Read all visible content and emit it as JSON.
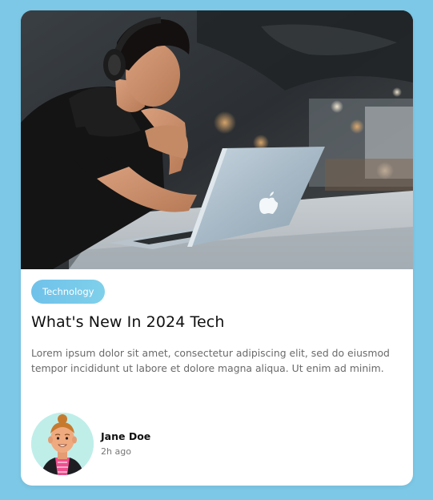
{
  "card": {
    "tag_label": "Technology",
    "title": "What's New In 2024 Tech",
    "body": "Lorem ipsum dolor sit amet, consectetur adipiscing elit, sed do eiusmod tempor incididunt ut labore et dolore magna aliqua. Ut enim ad minim.",
    "author": {
      "name": "Jane Doe",
      "time": "2h ago"
    }
  },
  "icons": {
    "avatar": "avatar-illustration",
    "laptop_logo": "apple-logo-icon"
  },
  "colors": {
    "background": "#7cc8e6",
    "card": "#ffffff",
    "tag_start": "#6fc1ea",
    "tag_end": "#7fd0ea",
    "title": "#111111",
    "body_text": "#6a6a6a",
    "avatar_bg": "#bfeee9"
  }
}
